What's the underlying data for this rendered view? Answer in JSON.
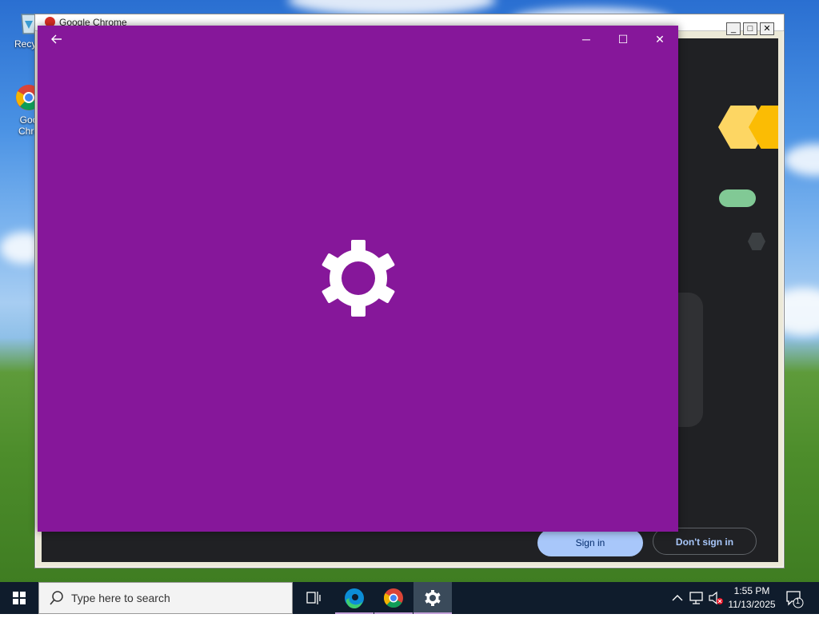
{
  "desktop": {
    "icons": [
      {
        "label": "Recycl",
        "icon": "recycle-bin-icon"
      },
      {
        "label": "Goo\nChro",
        "icon": "chrome-shortcut-icon"
      }
    ]
  },
  "background_window": {
    "title": "Google Chrome",
    "controls": [
      "_",
      "□",
      "✕"
    ],
    "buttons": {
      "sign_in": "Sign in",
      "dont_sign_in": "Don't sign in"
    },
    "colors": {
      "bg": "#202124",
      "accent_yellow": "#fdd663",
      "accent_green": "#81c995"
    }
  },
  "settings_splash": {
    "back_icon": "back-arrow-icon",
    "minimize": "─",
    "maximize": "☐",
    "close": "✕",
    "center_icon": "gear-icon",
    "accent_color": "#86179a"
  },
  "taskbar": {
    "search_placeholder": "Type here to search",
    "apps": [
      "task-view-icon",
      "edge-icon",
      "chrome-icon",
      "settings-icon"
    ],
    "clock_time": "1:55 PM",
    "clock_date": "11/13/2025",
    "notification_count": "1"
  }
}
